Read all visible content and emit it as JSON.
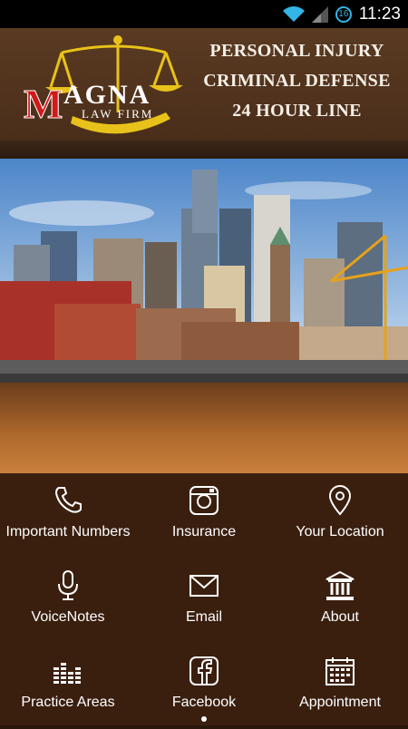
{
  "status": {
    "time": "11:23",
    "notification_count": "16"
  },
  "header": {
    "logo_text": "MAGNA",
    "logo_subtext": "LAW FIRM",
    "lines": [
      "PERSONAL INJURY",
      "CRIMINAL DEFENSE",
      "24 HOUR LINE"
    ]
  },
  "menu": [
    {
      "label": "Important Numbers",
      "icon": "phone-icon"
    },
    {
      "label": "Insurance",
      "icon": "camera-icon"
    },
    {
      "label": "Your Location",
      "icon": "location-pin-icon"
    },
    {
      "label": "VoiceNotes",
      "icon": "microphone-icon"
    },
    {
      "label": "Email",
      "icon": "envelope-icon"
    },
    {
      "label": "About",
      "icon": "courthouse-icon"
    },
    {
      "label": "Practice Areas",
      "icon": "equalizer-icon"
    },
    {
      "label": "Facebook",
      "icon": "facebook-icon"
    },
    {
      "label": "Appointment",
      "icon": "calendar-icon"
    }
  ],
  "colors": {
    "header": "#5a3a22",
    "menu_bg": "#3a1f0f",
    "accent_gold": "#e8c21a",
    "logo_red": "#d01a1a",
    "status_blue": "#33b5e5"
  }
}
